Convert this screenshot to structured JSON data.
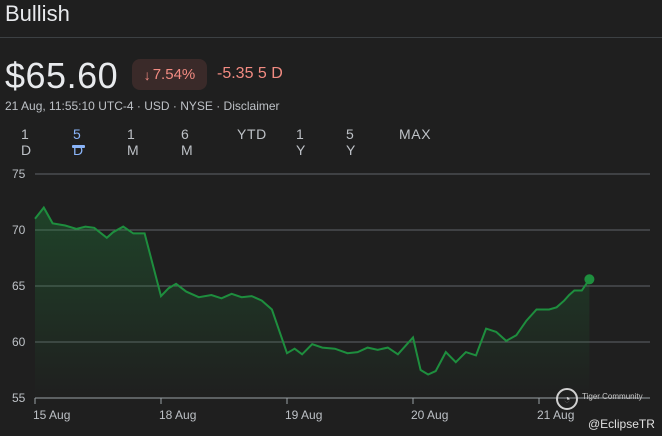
{
  "header": {
    "title": "Bullish"
  },
  "quote": {
    "price": "$65.60",
    "change_percent": "7.54%",
    "change_arrow": "↓",
    "change_value": "-5.35 5 D",
    "meta": "21 Aug, 11:55:10 UTC-4 · USD · NYSE · Disclaimer"
  },
  "tabs": [
    {
      "label": "1 D",
      "active": false
    },
    {
      "label": "5 D",
      "active": true
    },
    {
      "label": "1 M",
      "active": false
    },
    {
      "label": "6 M",
      "active": false
    },
    {
      "label": "YTD",
      "active": false
    },
    {
      "label": "1 Y",
      "active": false
    },
    {
      "label": "5 Y",
      "active": false
    },
    {
      "label": "MAX",
      "active": false
    }
  ],
  "colors": {
    "background": "#1f1f1f",
    "line": "#1e8e3e",
    "negative": "#f28b82",
    "accent": "#8ab4f8",
    "grid": "#5f6368"
  },
  "chart_data": {
    "type": "area",
    "ylim": [
      55,
      75
    ],
    "yticks": [
      75,
      70,
      65,
      60,
      55
    ],
    "xlabels": [
      "15 Aug",
      "18 Aug",
      "19 Aug",
      "20 Aug",
      "21 Aug"
    ],
    "x_tick_positions": [
      0,
      1,
      2,
      3,
      4
    ],
    "xlim": [
      0,
      4.28
    ],
    "grid": true,
    "series": [
      {
        "values": [
          [
            0.0,
            71.0
          ],
          [
            0.07,
            72.0
          ],
          [
            0.14,
            70.6
          ],
          [
            0.24,
            70.4
          ],
          [
            0.33,
            70.1
          ],
          [
            0.4,
            70.3
          ],
          [
            0.47,
            70.2
          ],
          [
            0.57,
            69.3
          ],
          [
            0.62,
            69.8
          ],
          [
            0.7,
            70.3
          ],
          [
            0.78,
            69.7
          ],
          [
            0.87,
            69.7
          ],
          [
            1.0,
            64.1
          ],
          [
            1.06,
            64.8
          ],
          [
            1.12,
            65.2
          ],
          [
            1.2,
            64.5
          ],
          [
            1.3,
            64.0
          ],
          [
            1.4,
            64.2
          ],
          [
            1.48,
            63.9
          ],
          [
            1.56,
            64.3
          ],
          [
            1.64,
            64.0
          ],
          [
            1.72,
            64.1
          ],
          [
            1.8,
            63.7
          ],
          [
            1.88,
            62.9
          ],
          [
            2.0,
            59.0
          ],
          [
            2.06,
            59.4
          ],
          [
            2.12,
            58.9
          ],
          [
            2.2,
            59.8
          ],
          [
            2.28,
            59.5
          ],
          [
            2.38,
            59.4
          ],
          [
            2.48,
            59.0
          ],
          [
            2.56,
            59.1
          ],
          [
            2.64,
            59.5
          ],
          [
            2.72,
            59.3
          ],
          [
            2.8,
            59.5
          ],
          [
            2.88,
            58.9
          ],
          [
            3.0,
            60.4
          ],
          [
            3.06,
            57.5
          ],
          [
            3.12,
            57.1
          ],
          [
            3.18,
            57.4
          ],
          [
            3.26,
            59.1
          ],
          [
            3.34,
            58.2
          ],
          [
            3.42,
            59.1
          ],
          [
            3.5,
            58.8
          ],
          [
            3.58,
            61.2
          ],
          [
            3.66,
            60.9
          ],
          [
            3.74,
            60.1
          ],
          [
            3.82,
            60.6
          ],
          [
            3.9,
            61.9
          ],
          [
            3.98,
            62.9
          ],
          [
            4.08,
            62.9
          ],
          [
            4.14,
            63.1
          ],
          [
            4.2,
            63.7
          ],
          [
            4.24,
            64.2
          ],
          [
            4.28,
            64.6
          ],
          [
            4.34,
            64.6
          ],
          [
            4.4,
            65.6
          ]
        ]
      }
    ]
  },
  "watermark": {
    "small_text": "Tiger Community",
    "handle": "@EclipseTR",
    "logo_icon": "tiger-logo-icon"
  }
}
